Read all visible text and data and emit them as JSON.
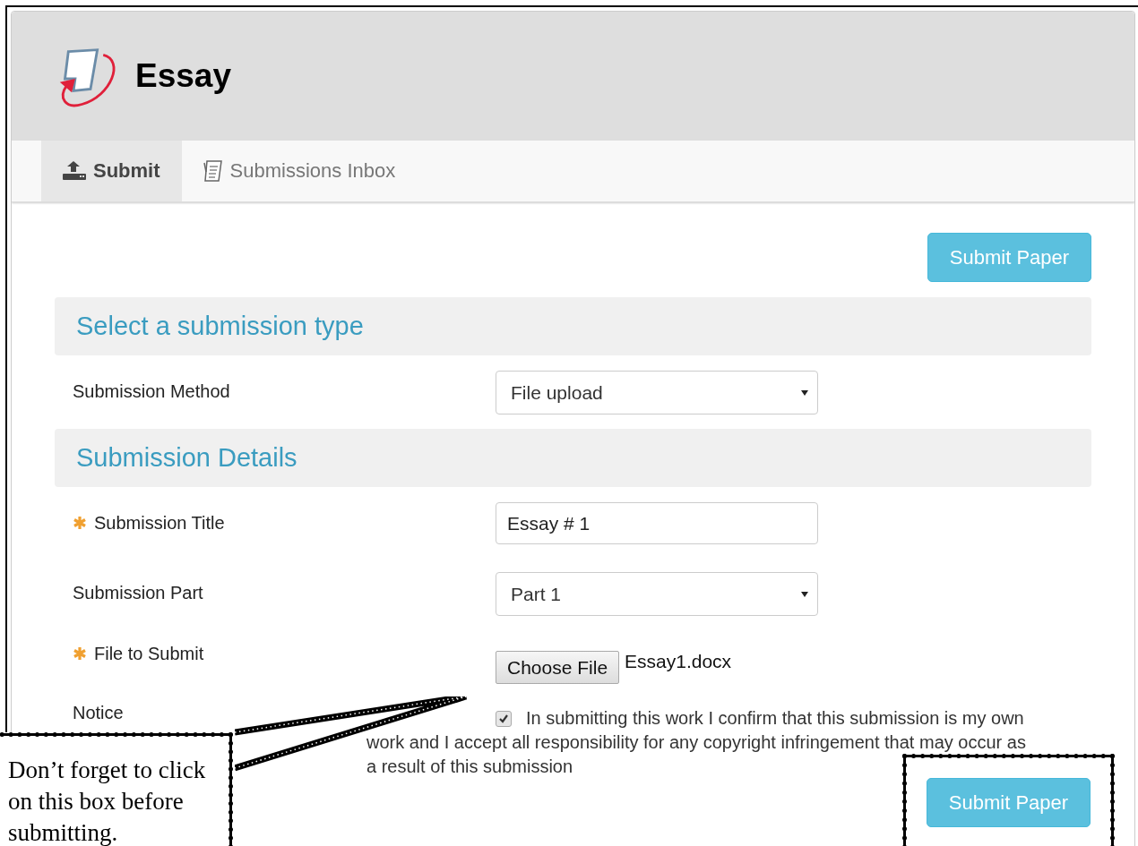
{
  "header": {
    "title": "Essay"
  },
  "tabs": [
    {
      "label": "Submit",
      "selected": true,
      "kind": "upload"
    },
    {
      "label": "Submissions Inbox",
      "selected": false,
      "kind": "inbox"
    }
  ],
  "top_button": "Submit Paper",
  "sections": [
    {
      "title": "Select a submission type",
      "fields": [
        {
          "kind": "select",
          "label": "Submission Method",
          "required": false,
          "value": "File upload"
        }
      ]
    },
    {
      "title": "Submission Details",
      "fields": [
        {
          "kind": "text",
          "label": "Submission Title",
          "required": true,
          "value": "Essay # 1"
        },
        {
          "kind": "select",
          "label": "Submission Part",
          "required": false,
          "value": "Part 1"
        },
        {
          "kind": "file",
          "label": "File to Submit",
          "required": true,
          "button": "Choose File",
          "value": "Essay1.docx"
        },
        {
          "kind": "notice",
          "label": "Notice",
          "required": false,
          "checked": true,
          "lines": [
            "In submitting this work I confirm that this submission is my own",
            "work and I accept all responsibility for any copyright infringement that may occur as",
            "a result of this submission"
          ]
        }
      ]
    }
  ],
  "bottom_button": {
    "label": "Submit Paper",
    "highlighted": true
  },
  "callout": {
    "text": "Don’t forget to click on this box before submitting."
  }
}
